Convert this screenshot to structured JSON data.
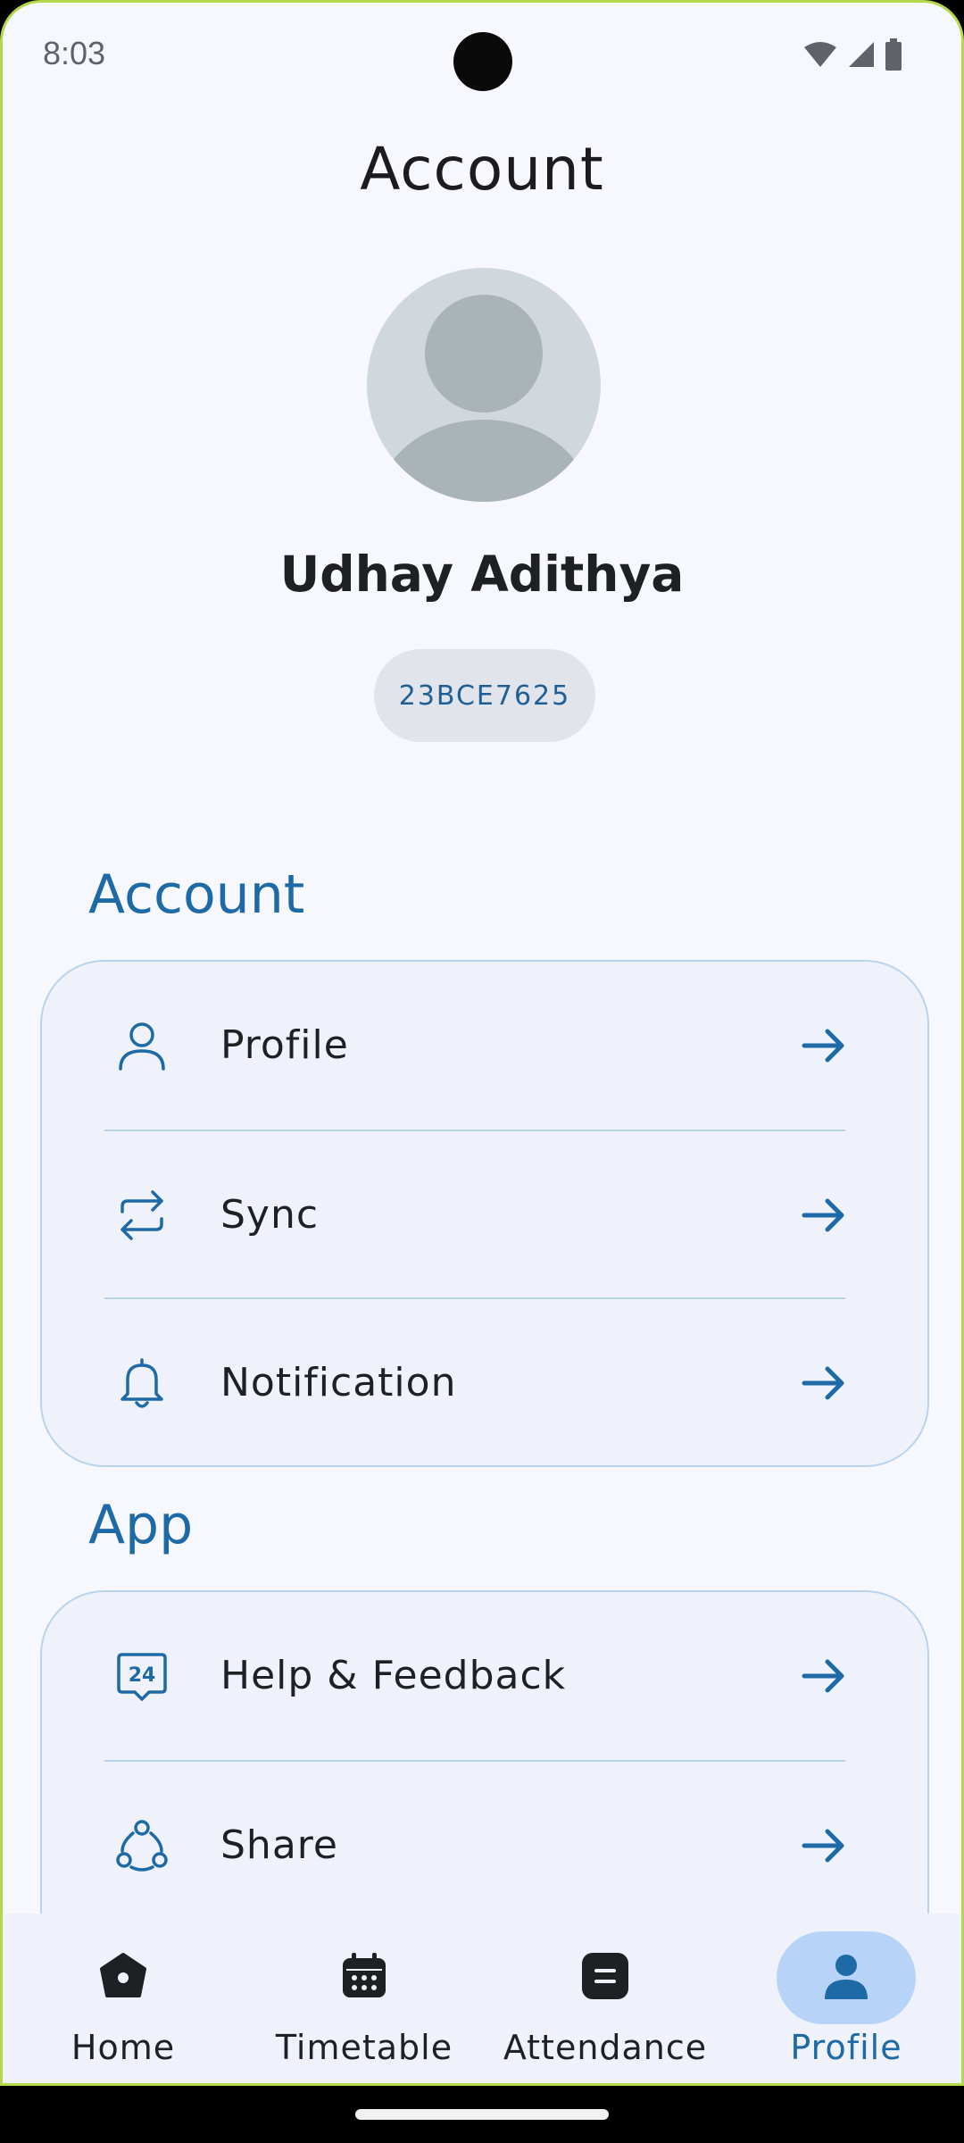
{
  "status_bar": {
    "time": "8:03",
    "icons": [
      "wifi-icon",
      "signal-icon",
      "battery-icon"
    ]
  },
  "header": {
    "title": "Account"
  },
  "profile": {
    "avatar": "default-avatar-icon",
    "name": "Udhay Adithya",
    "id": "23BCE7625"
  },
  "sections": {
    "account": {
      "title": "Account",
      "items": [
        {
          "label": "Profile",
          "icon": "person-icon"
        },
        {
          "label": "Sync",
          "icon": "sync-icon"
        },
        {
          "label": "Notification",
          "icon": "bell-icon"
        }
      ]
    },
    "app": {
      "title": "App",
      "items": [
        {
          "label": "Help & Feedback",
          "icon": "support-24-icon"
        },
        {
          "label": "Share",
          "icon": "share-icon"
        }
      ]
    }
  },
  "bottom_nav": {
    "items": [
      {
        "label": "Home",
        "icon": "home-icon",
        "active": false
      },
      {
        "label": "Timetable",
        "icon": "calendar-icon",
        "active": false
      },
      {
        "label": "Attendance",
        "icon": "attendance-icon",
        "active": false
      },
      {
        "label": "Profile",
        "icon": "person-filled-icon",
        "active": true
      }
    ]
  },
  "colors": {
    "accent": "#1e6aa6",
    "background": "#f7f8fd",
    "card": "#eff2fa",
    "card_border": "#b9d3ec",
    "nav_active_pill": "#b7d4f8"
  }
}
